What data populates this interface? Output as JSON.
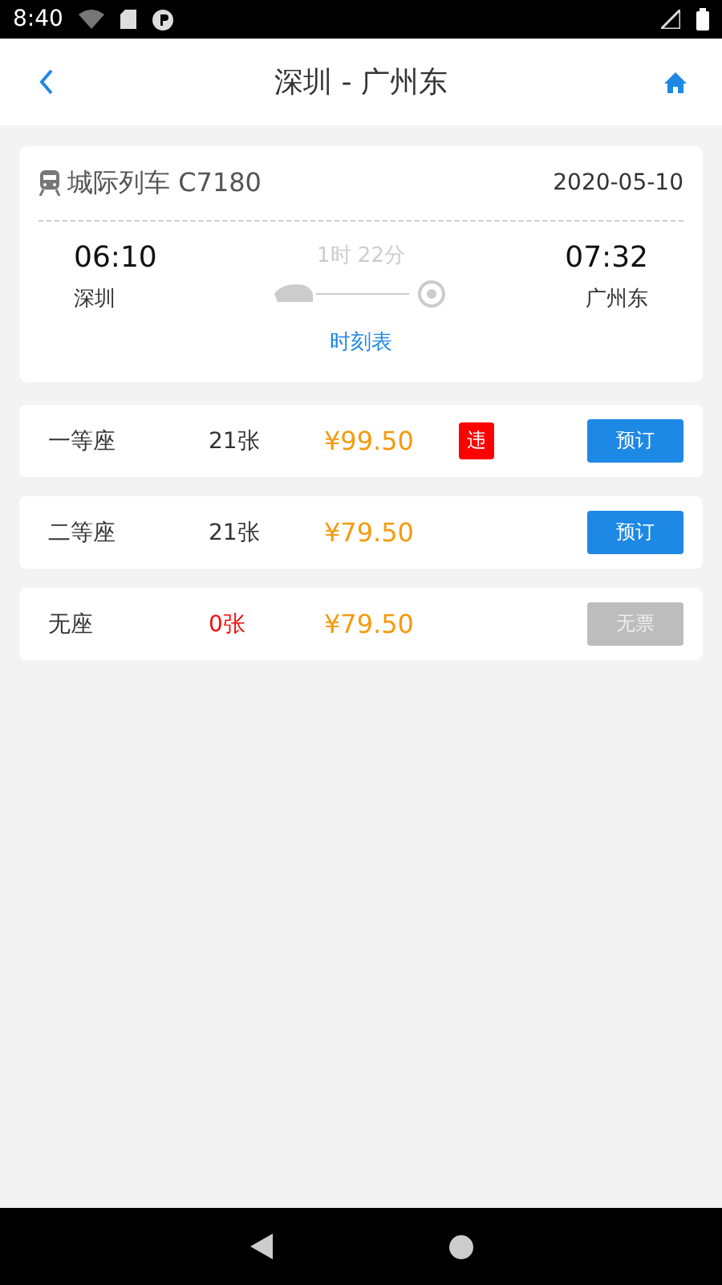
{
  "status_bar": {
    "time": "8:40"
  },
  "header": {
    "title": "深圳 - 广州东"
  },
  "trip": {
    "train": "城际列车 C7180",
    "date": "2020-05-10",
    "depart_time": "06:10",
    "depart_station": "深圳",
    "duration": "1时 22分",
    "arrive_time": "07:32",
    "arrive_station": "广州东",
    "timetable_link": "时刻表"
  },
  "seats": [
    {
      "name": "一等座",
      "count": "21张",
      "price": "¥99.50",
      "badge": "违",
      "available": true,
      "button": "预订"
    },
    {
      "name": "二等座",
      "count": "21张",
      "price": "¥79.50",
      "available": true,
      "button": "预订"
    },
    {
      "name": "无座",
      "count": "0张",
      "price": "¥79.50",
      "available": false,
      "button": "无票"
    }
  ]
}
